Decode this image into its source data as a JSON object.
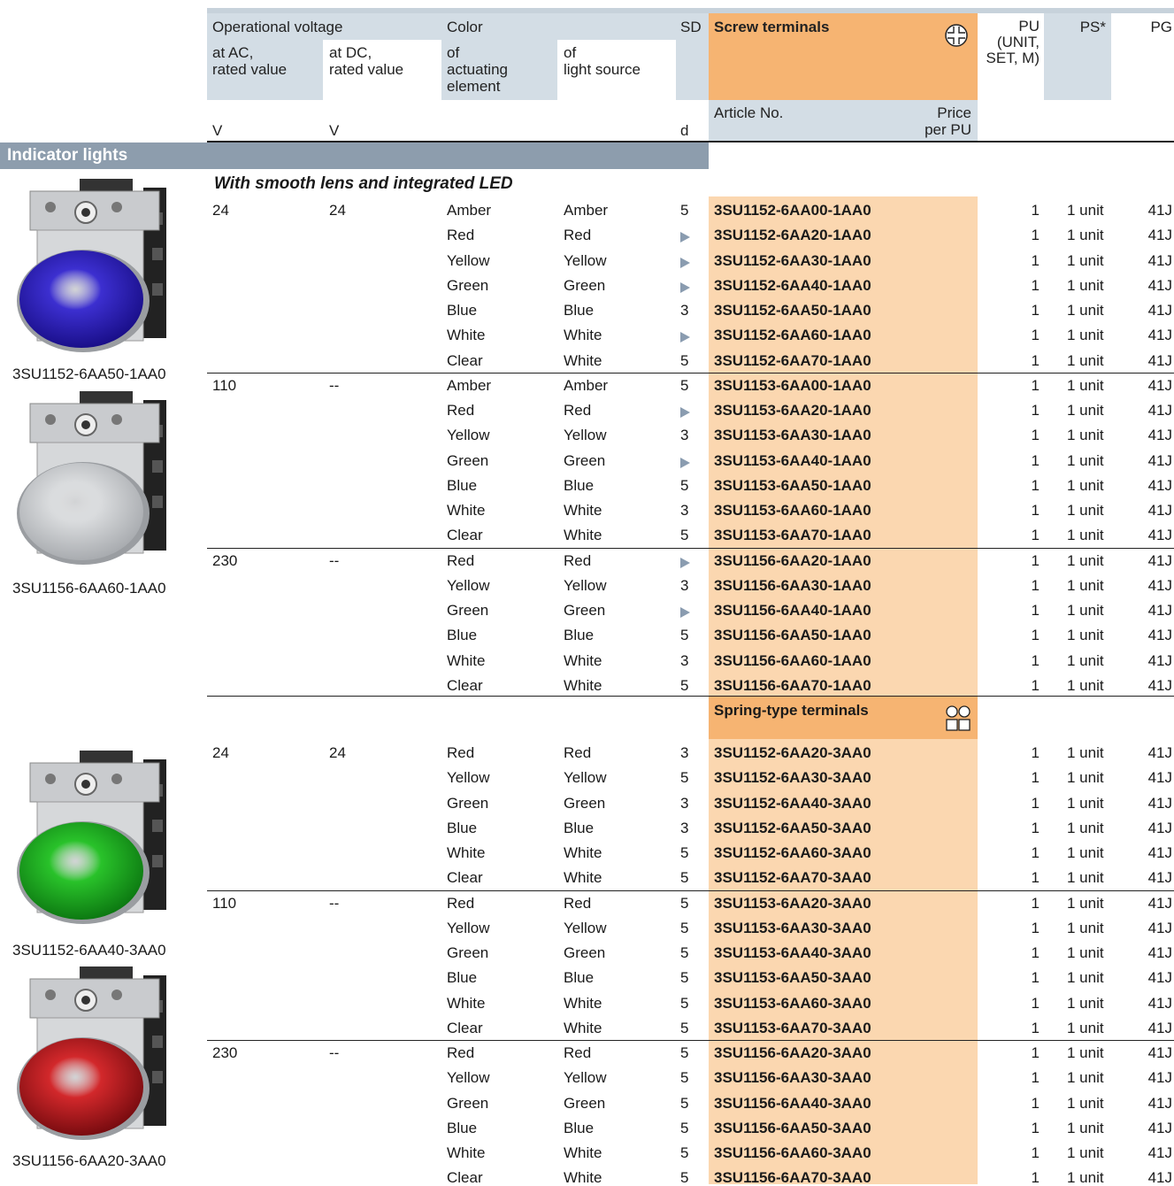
{
  "header": {
    "operational_voltage": "Operational voltage",
    "at_ac": "at AC,\nrated value",
    "at_dc": "at DC,\nrated value",
    "color": "Color",
    "of_actuating": "of\nactuating\nelement",
    "of_light": "of\nlight source",
    "sd": "SD",
    "screw_terminals": "Screw terminals",
    "pu": "PU\n(UNIT,\nSET, M)",
    "ps": "PS*",
    "pg": "PG",
    "article_no": "Article No.",
    "price": "Price\nper PU",
    "unit_v1": "V",
    "unit_v2": "V",
    "unit_d": "d"
  },
  "section_title": "Indicator lights",
  "subsection_title": "With smooth lens and integrated LED",
  "spring_title": "Spring-type terminals",
  "images": [
    {
      "caption": "3SU1152-6AA50-1AA0",
      "lens": "#3c2fd0",
      "lens_dark": "#1a0f8a"
    },
    {
      "caption": "3SU1156-6AA60-1AA0",
      "lens": "#d9dbdd",
      "lens_dark": "#a9acb0"
    },
    {
      "caption": "3SU1152-6AA40-3AA0",
      "lens": "#29c22a",
      "lens_dark": "#0d7a12"
    },
    {
      "caption": "3SU1156-6AA20-3AA0",
      "lens": "#d2282b",
      "lens_dark": "#7a0c10"
    }
  ],
  "screw_rows": [
    {
      "ac": "24",
      "dc": "24",
      "act": "Amber",
      "light": "Amber",
      "sd": "5",
      "art": "3SU1152-6AA00-1AA0",
      "pu": "1",
      "ps": "1 unit",
      "pg": "41J"
    },
    {
      "ac": "",
      "dc": "",
      "act": "Red",
      "light": "Red",
      "sd": "▶",
      "art": "3SU1152-6AA20-1AA0",
      "pu": "1",
      "ps": "1 unit",
      "pg": "41J"
    },
    {
      "ac": "",
      "dc": "",
      "act": "Yellow",
      "light": "Yellow",
      "sd": "▶",
      "art": "3SU1152-6AA30-1AA0",
      "pu": "1",
      "ps": "1 unit",
      "pg": "41J"
    },
    {
      "ac": "",
      "dc": "",
      "act": "Green",
      "light": "Green",
      "sd": "▶",
      "art": "3SU1152-6AA40-1AA0",
      "pu": "1",
      "ps": "1 unit",
      "pg": "41J"
    },
    {
      "ac": "",
      "dc": "",
      "act": "Blue",
      "light": "Blue",
      "sd": "3",
      "art": "3SU1152-6AA50-1AA0",
      "pu": "1",
      "ps": "1 unit",
      "pg": "41J"
    },
    {
      "ac": "",
      "dc": "",
      "act": "White",
      "light": "White",
      "sd": "▶",
      "art": "3SU1152-6AA60-1AA0",
      "pu": "1",
      "ps": "1 unit",
      "pg": "41J"
    },
    {
      "ac": "",
      "dc": "",
      "act": "Clear",
      "light": "White",
      "sd": "5",
      "art": "3SU1152-6AA70-1AA0",
      "pu": "1",
      "ps": "1 unit",
      "pg": "41J"
    },
    {
      "ac": "110",
      "dc": "--",
      "act": "Amber",
      "light": "Amber",
      "sd": "5",
      "art": "3SU1153-6AA00-1AA0",
      "pu": "1",
      "ps": "1 unit",
      "pg": "41J"
    },
    {
      "ac": "",
      "dc": "",
      "act": "Red",
      "light": "Red",
      "sd": "▶",
      "art": "3SU1153-6AA20-1AA0",
      "pu": "1",
      "ps": "1 unit",
      "pg": "41J"
    },
    {
      "ac": "",
      "dc": "",
      "act": "Yellow",
      "light": "Yellow",
      "sd": "3",
      "art": "3SU1153-6AA30-1AA0",
      "pu": "1",
      "ps": "1 unit",
      "pg": "41J"
    },
    {
      "ac": "",
      "dc": "",
      "act": "Green",
      "light": "Green",
      "sd": "▶",
      "art": "3SU1153-6AA40-1AA0",
      "pu": "1",
      "ps": "1 unit",
      "pg": "41J"
    },
    {
      "ac": "",
      "dc": "",
      "act": "Blue",
      "light": "Blue",
      "sd": "5",
      "art": "3SU1153-6AA50-1AA0",
      "pu": "1",
      "ps": "1 unit",
      "pg": "41J"
    },
    {
      "ac": "",
      "dc": "",
      "act": "White",
      "light": "White",
      "sd": "3",
      "art": "3SU1153-6AA60-1AA0",
      "pu": "1",
      "ps": "1 unit",
      "pg": "41J"
    },
    {
      "ac": "",
      "dc": "",
      "act": "Clear",
      "light": "White",
      "sd": "5",
      "art": "3SU1153-6AA70-1AA0",
      "pu": "1",
      "ps": "1 unit",
      "pg": "41J"
    },
    {
      "ac": "230",
      "dc": "--",
      "act": "Red",
      "light": "Red",
      "sd": "▶",
      "art": "3SU1156-6AA20-1AA0",
      "pu": "1",
      "ps": "1 unit",
      "pg": "41J"
    },
    {
      "ac": "",
      "dc": "",
      "act": "Yellow",
      "light": "Yellow",
      "sd": "3",
      "art": "3SU1156-6AA30-1AA0",
      "pu": "1",
      "ps": "1 unit",
      "pg": "41J"
    },
    {
      "ac": "",
      "dc": "",
      "act": "Green",
      "light": "Green",
      "sd": "▶",
      "art": "3SU1156-6AA40-1AA0",
      "pu": "1",
      "ps": "1 unit",
      "pg": "41J"
    },
    {
      "ac": "",
      "dc": "",
      "act": "Blue",
      "light": "Blue",
      "sd": "5",
      "art": "3SU1156-6AA50-1AA0",
      "pu": "1",
      "ps": "1 unit",
      "pg": "41J"
    },
    {
      "ac": "",
      "dc": "",
      "act": "White",
      "light": "White",
      "sd": "3",
      "art": "3SU1156-6AA60-1AA0",
      "pu": "1",
      "ps": "1 unit",
      "pg": "41J"
    },
    {
      "ac": "",
      "dc": "",
      "act": "Clear",
      "light": "White",
      "sd": "5",
      "art": "3SU1156-6AA70-1AA0",
      "pu": "1",
      "ps": "1 unit",
      "pg": "41J"
    }
  ],
  "spring_rows": [
    {
      "ac": "24",
      "dc": "24",
      "act": "Red",
      "light": "Red",
      "sd": "3",
      "art": "3SU1152-6AA20-3AA0",
      "pu": "1",
      "ps": "1 unit",
      "pg": "41J"
    },
    {
      "ac": "",
      "dc": "",
      "act": "Yellow",
      "light": "Yellow",
      "sd": "5",
      "art": "3SU1152-6AA30-3AA0",
      "pu": "1",
      "ps": "1 unit",
      "pg": "41J"
    },
    {
      "ac": "",
      "dc": "",
      "act": "Green",
      "light": "Green",
      "sd": "3",
      "art": "3SU1152-6AA40-3AA0",
      "pu": "1",
      "ps": "1 unit",
      "pg": "41J"
    },
    {
      "ac": "",
      "dc": "",
      "act": "Blue",
      "light": "Blue",
      "sd": "3",
      "art": "3SU1152-6AA50-3AA0",
      "pu": "1",
      "ps": "1 unit",
      "pg": "41J"
    },
    {
      "ac": "",
      "dc": "",
      "act": "White",
      "light": "White",
      "sd": "5",
      "art": "3SU1152-6AA60-3AA0",
      "pu": "1",
      "ps": "1 unit",
      "pg": "41J"
    },
    {
      "ac": "",
      "dc": "",
      "act": "Clear",
      "light": "White",
      "sd": "5",
      "art": "3SU1152-6AA70-3AA0",
      "pu": "1",
      "ps": "1 unit",
      "pg": "41J"
    },
    {
      "ac": "110",
      "dc": "--",
      "act": "Red",
      "light": "Red",
      "sd": "5",
      "art": "3SU1153-6AA20-3AA0",
      "pu": "1",
      "ps": "1 unit",
      "pg": "41J"
    },
    {
      "ac": "",
      "dc": "",
      "act": "Yellow",
      "light": "Yellow",
      "sd": "5",
      "art": "3SU1153-6AA30-3AA0",
      "pu": "1",
      "ps": "1 unit",
      "pg": "41J"
    },
    {
      "ac": "",
      "dc": "",
      "act": "Green",
      "light": "Green",
      "sd": "5",
      "art": "3SU1153-6AA40-3AA0",
      "pu": "1",
      "ps": "1 unit",
      "pg": "41J"
    },
    {
      "ac": "",
      "dc": "",
      "act": "Blue",
      "light": "Blue",
      "sd": "5",
      "art": "3SU1153-6AA50-3AA0",
      "pu": "1",
      "ps": "1 unit",
      "pg": "41J"
    },
    {
      "ac": "",
      "dc": "",
      "act": "White",
      "light": "White",
      "sd": "5",
      "art": "3SU1153-6AA60-3AA0",
      "pu": "1",
      "ps": "1 unit",
      "pg": "41J"
    },
    {
      "ac": "",
      "dc": "",
      "act": "Clear",
      "light": "White",
      "sd": "5",
      "art": "3SU1153-6AA70-3AA0",
      "pu": "1",
      "ps": "1 unit",
      "pg": "41J"
    },
    {
      "ac": "230",
      "dc": "--",
      "act": "Red",
      "light": "Red",
      "sd": "5",
      "art": "3SU1156-6AA20-3AA0",
      "pu": "1",
      "ps": "1 unit",
      "pg": "41J"
    },
    {
      "ac": "",
      "dc": "",
      "act": "Yellow",
      "light": "Yellow",
      "sd": "5",
      "art": "3SU1156-6AA30-3AA0",
      "pu": "1",
      "ps": "1 unit",
      "pg": "41J"
    },
    {
      "ac": "",
      "dc": "",
      "act": "Green",
      "light": "Green",
      "sd": "5",
      "art": "3SU1156-6AA40-3AA0",
      "pu": "1",
      "ps": "1 unit",
      "pg": "41J"
    },
    {
      "ac": "",
      "dc": "",
      "act": "Blue",
      "light": "Blue",
      "sd": "5",
      "art": "3SU1156-6AA50-3AA0",
      "pu": "1",
      "ps": "1 unit",
      "pg": "41J"
    },
    {
      "ac": "",
      "dc": "",
      "act": "White",
      "light": "White",
      "sd": "5",
      "art": "3SU1156-6AA60-3AA0",
      "pu": "1",
      "ps": "1 unit",
      "pg": "41J"
    },
    {
      "ac": "",
      "dc": "",
      "act": "Clear",
      "light": "White",
      "sd": "5",
      "art": "3SU1156-6AA70-3AA0",
      "pu": "1",
      "ps": "1 unit",
      "pg": "41J"
    }
  ]
}
